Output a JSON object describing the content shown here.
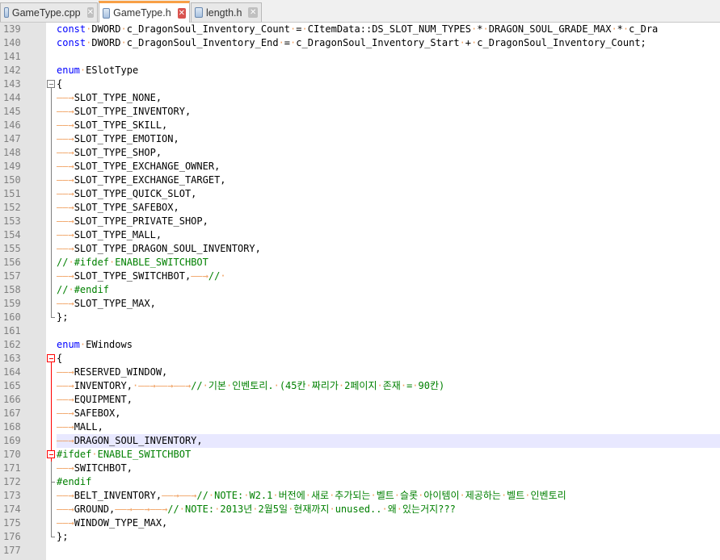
{
  "tabs": [
    {
      "label": "GameType.cpp",
      "active": false
    },
    {
      "label": "GameType.h",
      "active": true
    },
    {
      "label": "length.h",
      "active": false
    }
  ],
  "lines": [
    {
      "n": "139",
      "fold": "none",
      "html": "<span class=\"kw\">const</span><span class=\"dot\">·</span>DWORD<span class=\"dot\">·</span>c_DragonSoul_Inventory_Count<span class=\"dot\">·</span>=<span class=\"dot\">·</span>CItemData::DS_SLOT_NUM_TYPES<span class=\"dot\">·</span>*<span class=\"dot\">·</span>DRAGON_SOUL_GRADE_MAX<span class=\"dot\">·</span>*<span class=\"dot\">·</span>c_Dra"
    },
    {
      "n": "140",
      "fold": "none",
      "html": "<span class=\"kw\">const</span><span class=\"dot\">·</span>DWORD<span class=\"dot\">·</span>c_DragonSoul_Inventory_End<span class=\"dot\">·</span>=<span class=\"dot\">·</span>c_DragonSoul_Inventory_Start<span class=\"dot\">·</span>+<span class=\"dot\">·</span>c_DragonSoul_Inventory_Count;"
    },
    {
      "n": "141",
      "fold": "none",
      "html": ""
    },
    {
      "n": "142",
      "fold": "none",
      "html": "<span class=\"kw\">enum</span><span class=\"dot\">·</span>ESlotType"
    },
    {
      "n": "143",
      "fold": "open",
      "html": "{"
    },
    {
      "n": "144",
      "fold": "bar",
      "html": "<span class=\"tabarrow\">——→</span>SLOT_TYPE_NONE,"
    },
    {
      "n": "145",
      "fold": "bar",
      "html": "<span class=\"tabarrow\">——→</span>SLOT_TYPE_INVENTORY,"
    },
    {
      "n": "146",
      "fold": "bar",
      "html": "<span class=\"tabarrow\">——→</span>SLOT_TYPE_SKILL,"
    },
    {
      "n": "147",
      "fold": "bar",
      "html": "<span class=\"tabarrow\">——→</span>SLOT_TYPE_EMOTION,"
    },
    {
      "n": "148",
      "fold": "bar",
      "html": "<span class=\"tabarrow\">——→</span>SLOT_TYPE_SHOP,"
    },
    {
      "n": "149",
      "fold": "bar",
      "html": "<span class=\"tabarrow\">——→</span>SLOT_TYPE_EXCHANGE_OWNER,"
    },
    {
      "n": "150",
      "fold": "bar",
      "html": "<span class=\"tabarrow\">——→</span>SLOT_TYPE_EXCHANGE_TARGET,"
    },
    {
      "n": "151",
      "fold": "bar",
      "html": "<span class=\"tabarrow\">——→</span>SLOT_TYPE_QUICK_SLOT,"
    },
    {
      "n": "152",
      "fold": "bar",
      "html": "<span class=\"tabarrow\">——→</span>SLOT_TYPE_SAFEBOX,"
    },
    {
      "n": "153",
      "fold": "bar",
      "html": "<span class=\"tabarrow\">——→</span>SLOT_TYPE_PRIVATE_SHOP,"
    },
    {
      "n": "154",
      "fold": "bar",
      "html": "<span class=\"tabarrow\">——→</span>SLOT_TYPE_MALL,"
    },
    {
      "n": "155",
      "fold": "bar",
      "html": "<span class=\"tabarrow\">——→</span>SLOT_TYPE_DRAGON_SOUL_INVENTORY,"
    },
    {
      "n": "156",
      "fold": "bar",
      "html": "<span class=\"cm\">//<span class=\"dot\">·</span>#ifdef<span class=\"dot\">·</span>ENABLE_SWITCHBOT</span>"
    },
    {
      "n": "157",
      "fold": "bar",
      "html": "<span class=\"tabarrow\">——→</span>SLOT_TYPE_SWITCHBOT,<span class=\"tabarrow\">——→</span><span class=\"cm\">//<span class=\"dot\">·</span></span>"
    },
    {
      "n": "158",
      "fold": "bar",
      "html": "<span class=\"cm\">//<span class=\"dot\">·</span>#endif</span>"
    },
    {
      "n": "159",
      "fold": "bar",
      "html": "<span class=\"tabarrow\">——→</span>SLOT_TYPE_MAX,"
    },
    {
      "n": "160",
      "fold": "end",
      "html": "};"
    },
    {
      "n": "161",
      "fold": "none",
      "html": ""
    },
    {
      "n": "162",
      "fold": "none",
      "html": "<span class=\"kw\">enum</span><span class=\"dot\">·</span>EWindows"
    },
    {
      "n": "163",
      "fold": "open-red",
      "html": "{"
    },
    {
      "n": "164",
      "fold": "bar-red",
      "html": "<span class=\"tabarrow\">——→</span>RESERVED_WINDOW,"
    },
    {
      "n": "165",
      "fold": "bar-red",
      "html": "<span class=\"tabarrow\">——→</span>INVENTORY,<span class=\"tabarrow\">·——→——→——→</span><span class=\"cm\">//<span class=\"dot\">·</span>기본<span class=\"dot\">·</span>인벤토리.<span class=\"dot\">·</span>(45칸<span class=\"dot\">·</span>짜리가<span class=\"dot\">·</span>2페이지<span class=\"dot\">·</span>존재<span class=\"dot\">·</span>=<span class=\"dot\">·</span>90칸)</span>"
    },
    {
      "n": "166",
      "fold": "bar-red",
      "html": "<span class=\"tabarrow\">——→</span>EQUIPMENT,"
    },
    {
      "n": "167",
      "fold": "bar-red",
      "html": "<span class=\"tabarrow\">——→</span>SAFEBOX,"
    },
    {
      "n": "168",
      "fold": "bar-red",
      "html": "<span class=\"tabarrow\">——→</span>MALL,"
    },
    {
      "n": "169",
      "fold": "bar-red",
      "hl": true,
      "html": "<span class=\"tabarrow\">——→</span>DRAGON_SOUL_INVENTORY,"
    },
    {
      "n": "170",
      "fold": "open-red-inner",
      "html": "<span class=\"cm\">#ifdef<span class=\"dot\">·</span>ENABLE_SWITCHBOT</span>"
    },
    {
      "n": "171",
      "fold": "bar",
      "html": "<span class=\"tabarrow\">——→</span>SWITCHBOT,"
    },
    {
      "n": "172",
      "fold": "end-mid",
      "html": "<span class=\"cm\">#endif</span>"
    },
    {
      "n": "173",
      "fold": "bar",
      "html": "<span class=\"tabarrow\">——→</span>BELT_INVENTORY,<span class=\"tabarrow\">——→——→</span><span class=\"cm\">//<span class=\"dot\">·</span>NOTE:<span class=\"dot\">·</span>W2.1<span class=\"dot\">·</span>버전에<span class=\"dot\">·</span>새로<span class=\"dot\">·</span>추가되는<span class=\"dot\">·</span>벨트<span class=\"dot\">·</span>슬롯<span class=\"dot\">·</span>아이템이<span class=\"dot\">·</span>제공하는<span class=\"dot\">·</span>벨트<span class=\"dot\">·</span>인벤토리</span>"
    },
    {
      "n": "174",
      "fold": "bar",
      "html": "<span class=\"tabarrow\">——→</span>GROUND,<span class=\"tabarrow\">——→——→——→</span><span class=\"cm\">//<span class=\"dot\">·</span>NOTE:<span class=\"dot\">·</span>2013년<span class=\"dot\">·</span>2월5일<span class=\"dot\">·</span>현재까지<span class=\"dot\">·</span>unused..<span class=\"dot\">·</span>왜<span class=\"dot\">·</span>있는거지???</span>"
    },
    {
      "n": "175",
      "fold": "bar",
      "html": "<span class=\"tabarrow\">——→</span>WINDOW_TYPE_MAX,"
    },
    {
      "n": "176",
      "fold": "end",
      "html": "};"
    },
    {
      "n": "177",
      "fold": "none",
      "html": ""
    }
  ]
}
